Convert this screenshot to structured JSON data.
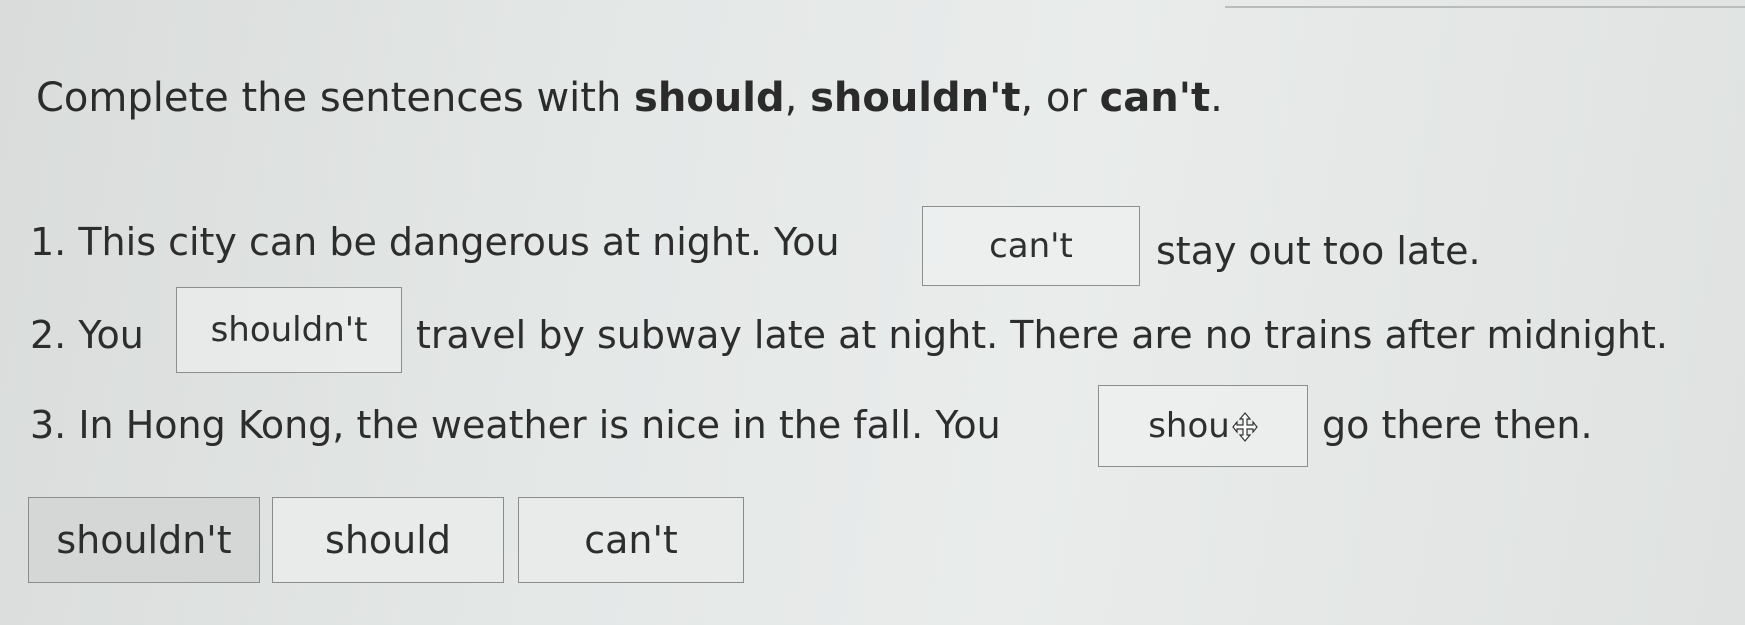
{
  "instruction": {
    "prefix": "Complete the sentences with ",
    "word1": "should",
    "sep1": ", ",
    "word2": "shouldn't",
    "sep2": ", or ",
    "word3": "can't",
    "suffix": "."
  },
  "sentences": [
    {
      "before": "1. This city can be dangerous at night. You",
      "answer": "can't",
      "after": "stay out too late."
    },
    {
      "before": "2. You",
      "answer": "shouldn't",
      "after": "travel by subway late at night. There are no trains after midnight."
    },
    {
      "before": "3. In Hong Kong, the weather is nice in the fall. You",
      "answer": "shou",
      "after": "go there then."
    }
  ],
  "options": [
    {
      "label": "shouldn't",
      "state": "used"
    },
    {
      "label": "should",
      "state": "free"
    },
    {
      "label": "can't",
      "state": "free"
    }
  ],
  "icons": {
    "drag_cursor": "move-cursor-icon"
  },
  "colors": {
    "box_border": "#8c8f8e",
    "used_option_bg": "#d4d7d6"
  }
}
